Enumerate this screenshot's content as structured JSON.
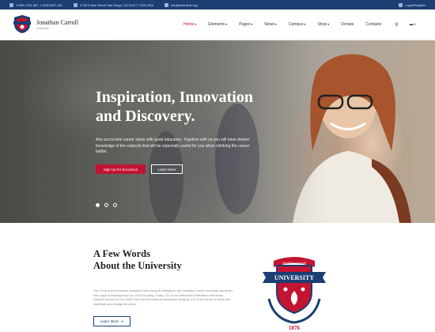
{
  "topbar": {
    "phone": "1-800-1234-567, 1-800-6547-321",
    "address": "2730 Fulton Street San Diego, CA 94117 7-000 USA",
    "email": "info@demolink.org",
    "login": "Login/Register"
  },
  "brand": {
    "name": "Jonathan Carroll",
    "sub": "University"
  },
  "nav": {
    "items": [
      {
        "label": "Home",
        "caret": "▾"
      },
      {
        "label": "Elements",
        "caret": "▾"
      },
      {
        "label": "Pages",
        "caret": "▾"
      },
      {
        "label": "News",
        "caret": "▾"
      },
      {
        "label": "Campus",
        "caret": "▾"
      },
      {
        "label": "Shop",
        "caret": "▾"
      },
      {
        "label": "Donate",
        "caret": ""
      },
      {
        "label": "Contacts",
        "caret": ""
      }
    ],
    "search_icon": "⚲",
    "cart_icon": "🛒",
    "cart_count": "0"
  },
  "hero": {
    "title_line1": "Inspiration, Innovation",
    "title_line2": "and Discovery.",
    "description": "Any successful career starts with good education. Together with us you will have deeper knowledge of the subjects that will be especially useful for you when climbing the career ladder.",
    "primary_button": "Sign Up for Excursion",
    "secondary_button": "Learn More"
  },
  "about": {
    "title_line1": "A Few Words",
    "title_line2": "About the University",
    "text": "One of the world's premier academic and research institutions, the Jonathan Carroll University has driven new ways of thinking since our 1876 founding. Today, JCU is an intellectual destination that draws inspired scholars to our Hyde Park and international campuses, keeping JCU at the nexus of ideas that challenge and change the world.",
    "button": "Learn More",
    "button_arrow": "➜"
  },
  "crest": {
    "top_text": "Jonathan Carroll",
    "banner_text": "UNIVERSITY",
    "year": "1876"
  },
  "colors": {
    "navy": "#1b3e73",
    "red": "#c31431"
  }
}
